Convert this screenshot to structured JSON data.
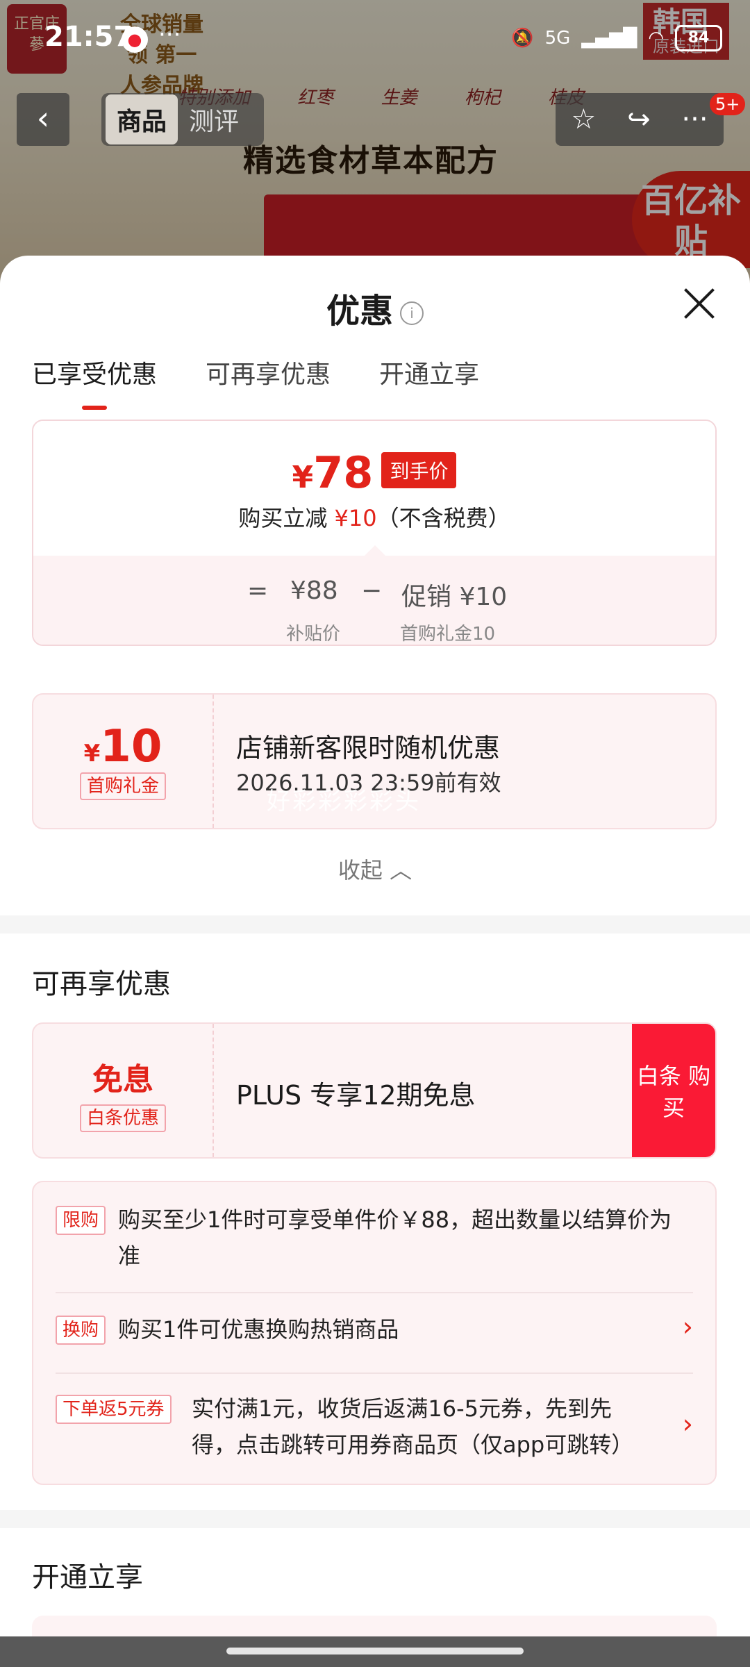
{
  "status_bar": {
    "time": "21:57",
    "network": "5G",
    "battery": "84"
  },
  "background": {
    "logo_text": "正官庄 蔘",
    "brand_text": "全球销量领 第一 人参品牌",
    "badge_korea": "韩国",
    "badge_korea_sub": "原装进口",
    "feature_labels": [
      "特别添加",
      "红枣",
      "生姜",
      "枸杞",
      "桂皮"
    ],
    "headline": "精选食材草本配方",
    "subsidy_badge": "百亿补贴"
  },
  "navbar": {
    "tabs": [
      "商品",
      "测评"
    ],
    "badge": "5+"
  },
  "sheet": {
    "title": "优惠",
    "tabs": [
      "已享受优惠",
      "可再享优惠",
      "开通立享"
    ],
    "price_card": {
      "currency": "¥",
      "final_price": "78",
      "final_tag": "到手价",
      "reduction_prefix": "购买立减",
      "reduction_amount": "¥10",
      "reduction_suffix": "（不含税费）",
      "eq": "=",
      "base_price": "¥88",
      "base_label": "补贴价",
      "minus": "−",
      "promo": "促销 ¥10",
      "promo_label": "首购礼金10"
    },
    "coupon_enjoyed": {
      "currency": "¥",
      "amount": "10",
      "pill": "首购礼金",
      "title": "店铺新客限时随机优惠",
      "expire": "2026.11.03 23:59前有效",
      "watermark": "好彩彩彩彩头"
    },
    "collapse_label": "收起",
    "more_section": {
      "title": "可再享优惠",
      "coupon": {
        "amount_text": "免息",
        "pill": "白条优惠",
        "title": "PLUS 专享12期免息",
        "button": "白条 购买"
      },
      "rules": [
        {
          "chip": "限购",
          "text": "购买至少1件时可享受单件价￥88，超出数量以结算价为准"
        },
        {
          "chip": "换购",
          "text": "购买1件可优惠换购热销商品"
        },
        {
          "chip": "下单返5元券",
          "text": "实付满1元，收货后返满16-5元券，先到先得，点击跳转可用券商品页（仅app可跳转）"
        }
      ]
    },
    "open_section_title": "开通立享"
  }
}
